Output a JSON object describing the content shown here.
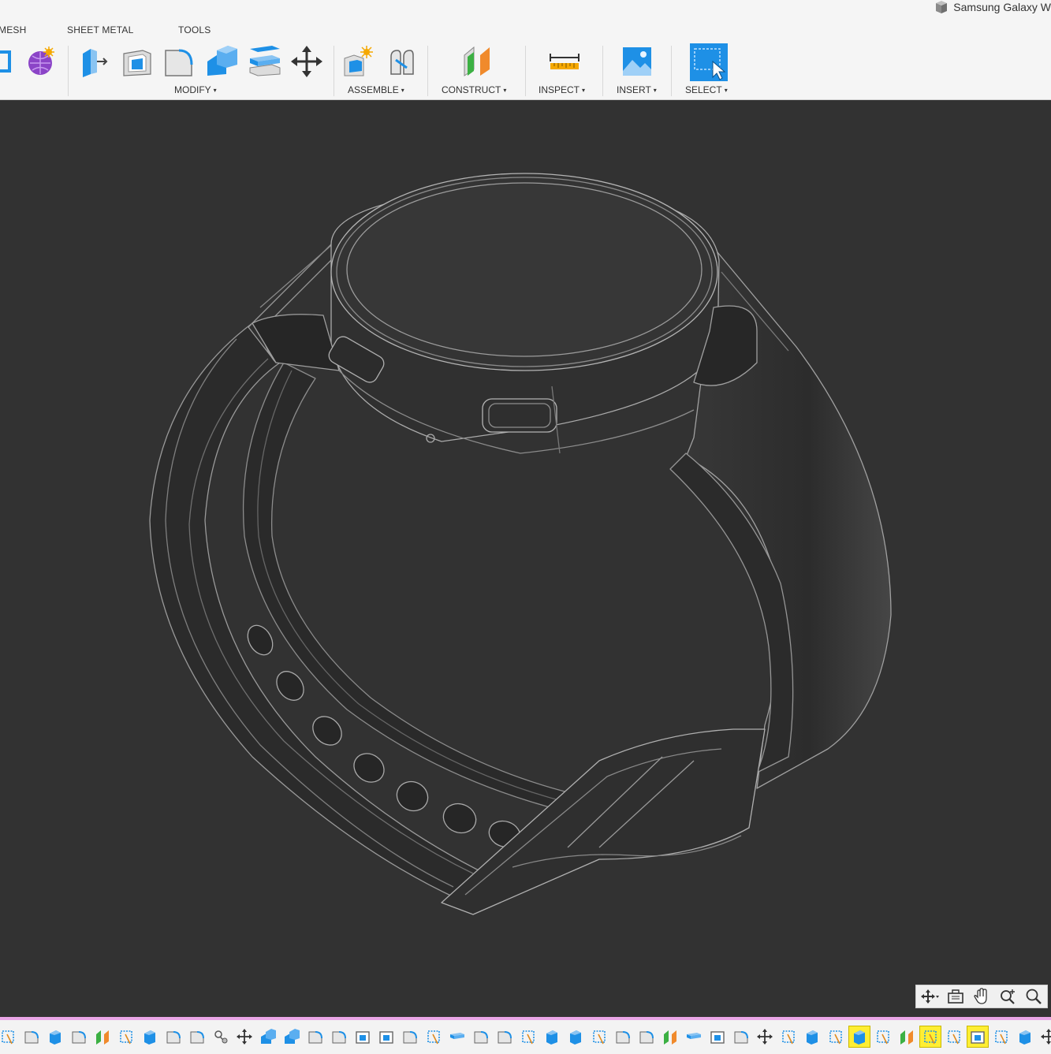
{
  "app": {
    "document_title": "Samsung Galaxy W"
  },
  "ribbon": {
    "tabs": [
      "MESH",
      "SHEET METAL",
      "TOOLS"
    ],
    "groups": {
      "modify": "MODIFY",
      "assemble": "ASSEMBLE",
      "construct": "CONSTRUCT",
      "inspect": "INSPECT",
      "insert": "INSERT",
      "select": "SELECT"
    },
    "dropdown_glyph": "▾",
    "tool_icons": [
      "sketch-icon",
      "form-icon",
      "press-pull-icon",
      "shell-icon",
      "fillet-icon",
      "combine-icon",
      "offset-face-icon",
      "move-icon",
      "new-component-icon",
      "joint-icon",
      "plane-icon",
      "measure-icon",
      "insert-image-icon",
      "select-window-icon"
    ]
  },
  "navigation_bar": {
    "icons": [
      "orbit-icon",
      "look-at-icon",
      "pan-icon",
      "zoom-icon",
      "fit-icon"
    ]
  },
  "timeline": {
    "icons": [
      "sketch-icon",
      "fillet-icon",
      "extrude-icon",
      "fillet-icon",
      "plane-icon",
      "sketch-icon",
      "extrude-icon",
      "fillet-icon",
      "fillet-icon",
      "joint-icon",
      "move-icon",
      "combine-icon",
      "combine-icon",
      "fillet-icon",
      "fillet-icon",
      "shell-icon",
      "shell-icon",
      "fillet-icon",
      "sketch-icon",
      "offset-icon",
      "fillet-icon",
      "fillet-icon",
      "sketch-icon",
      "extrude-icon",
      "extrude-icon",
      "sketch-icon",
      "fillet-icon",
      "fillet-icon",
      "plane-icon",
      "offset-icon",
      "shell-icon",
      "fillet-icon",
      "move-icon",
      "sketch-icon",
      "extrude-icon",
      "sketch-icon",
      "extrude-icon",
      "sketch-icon",
      "plane-icon",
      "sketch-icon",
      "sketch-icon",
      "shell-icon",
      "sketch-icon",
      "extrude-icon",
      "move-icon"
    ],
    "highlighted_indices": [
      36,
      39,
      41
    ],
    "highlight_color": "#ffee33",
    "bar_color": "#e9a5e6"
  },
  "colors": {
    "viewport_background": "#323232",
    "toolbar_background": "#f5f5f5",
    "accent_blue": "#1e90e6"
  }
}
